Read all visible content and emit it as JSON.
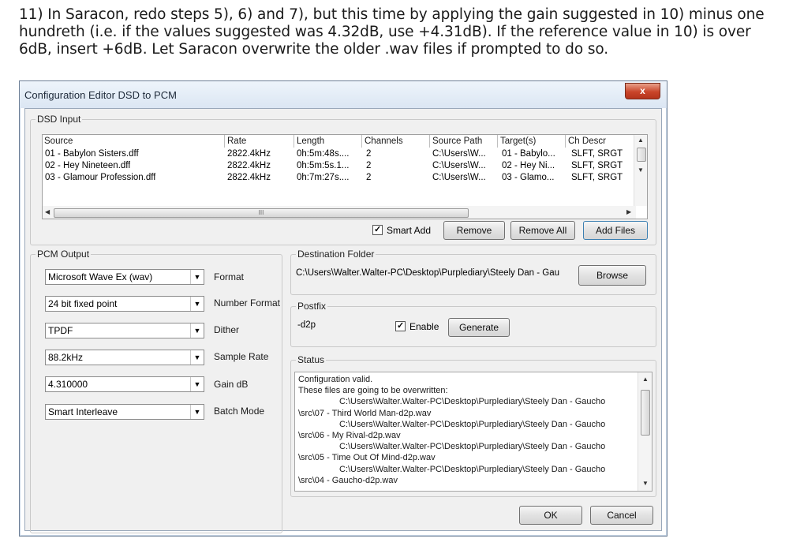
{
  "instruction": "11) In Saracon, redo steps 5), 6) and 7), but this time by applying the gain suggested in 10) minus one hundreth (i.e. if the values suggested was 4.32dB, use +4.31dB). If the reference value in 10) is over 6dB, insert +6dB. Let Saracon overwrite the older .wav files if prompted to do so.",
  "window": {
    "title": "Configuration Editor DSD to PCM",
    "close": "x"
  },
  "dsd_input": {
    "label": "DSD Input",
    "columns": [
      "Source",
      "Rate",
      "Length",
      "Channels",
      "Source Path",
      "Target(s)",
      "Ch Descr"
    ],
    "rows": [
      [
        "01 - Babylon Sisters.dff",
        "2822.4kHz",
        "0h:5m:48s....",
        "2",
        "C:\\Users\\W...",
        "01 - Babylo...",
        "SLFT, SRGT"
      ],
      [
        "02 - Hey Nineteen.dff",
        "2822.4kHz",
        "0h:5m:5s.1...",
        "2",
        "C:\\Users\\W...",
        "02 - Hey Ni...",
        "SLFT, SRGT"
      ],
      [
        "03 - Glamour Profession.dff",
        "2822.4kHz",
        "0h:7m:27s....",
        "2",
        "C:\\Users\\W...",
        "03 - Glamo...",
        "SLFT, SRGT"
      ]
    ],
    "scroll_grip": "III",
    "smart_add": "Smart Add",
    "remove": "Remove",
    "remove_all": "Remove All",
    "add_files": "Add Files"
  },
  "pcm_output": {
    "label": "PCM Output",
    "fields": [
      {
        "value": "Microsoft Wave Ex (wav)",
        "label": "Format"
      },
      {
        "value": "24 bit fixed point",
        "label": "Number Format"
      },
      {
        "value": "TPDF",
        "label": "Dither"
      },
      {
        "value": "88.2kHz",
        "label": "Sample Rate"
      },
      {
        "value": "4.310000",
        "label": "Gain dB"
      },
      {
        "value": "Smart Interleave",
        "label": "Batch Mode"
      }
    ]
  },
  "destination": {
    "label": "Destination Folder",
    "path": "C:\\Users\\Walter.Walter-PC\\Desktop\\Purplediary\\Steely Dan - Gau",
    "browse": "Browse"
  },
  "postfix": {
    "label": "Postfix",
    "value": "-d2p",
    "enable": "Enable",
    "generate": "Generate"
  },
  "status": {
    "label": "Status",
    "lines": [
      "Configuration valid.",
      "These files are going to be overwritten:",
      "C:\\Users\\Walter.Walter-PC\\Desktop\\Purplediary\\Steely Dan - Gaucho",
      "\\src\\07 - Third World Man-d2p.wav",
      "C:\\Users\\Walter.Walter-PC\\Desktop\\Purplediary\\Steely Dan - Gaucho",
      "\\src\\06 - My Rival-d2p.wav",
      "C:\\Users\\Walter.Walter-PC\\Desktop\\Purplediary\\Steely Dan - Gaucho",
      "\\src\\05 - Time Out Of Mind-d2p.wav",
      "C:\\Users\\Walter.Walter-PC\\Desktop\\Purplediary\\Steely Dan - Gaucho",
      "\\src\\04 - Gaucho-d2p.wav"
    ]
  },
  "footer": {
    "ok": "OK",
    "cancel": "Cancel"
  }
}
